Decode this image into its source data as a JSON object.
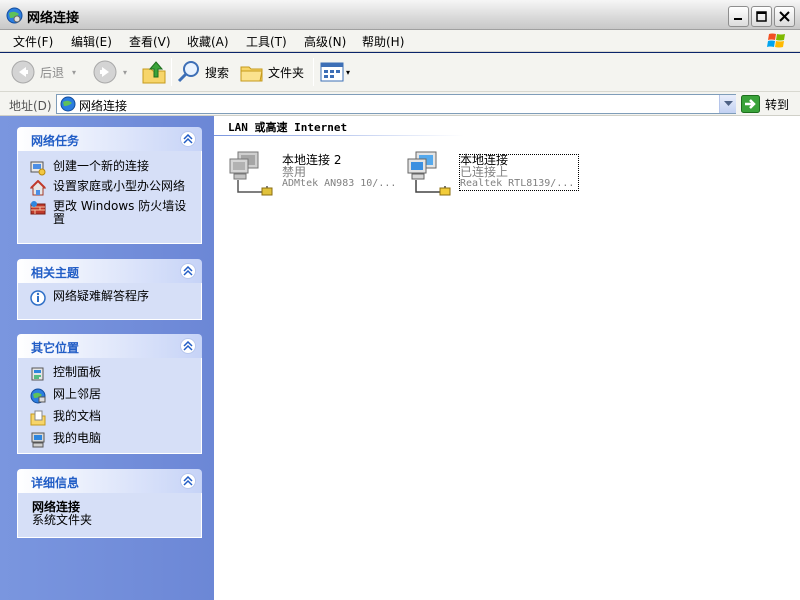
{
  "window": {
    "title": "网络连接",
    "buttons": {
      "minimize": "minimize",
      "maximize": "maximize",
      "close": "close"
    }
  },
  "menu": [
    "文件(F)",
    "编辑(E)",
    "查看(V)",
    "收藏(A)",
    "工具(T)",
    "高级(N)",
    "帮助(H)"
  ],
  "toolbar": {
    "back_label": "后退",
    "search_label": "搜索",
    "folders_label": "文件夹"
  },
  "address": {
    "label": "地址(D)",
    "value": "网络连接",
    "go_label": "转到"
  },
  "sidebar": {
    "panels": [
      {
        "title": "网络任务",
        "items": [
          {
            "label": "创建一个新的连接",
            "icon": "new-connection-icon"
          },
          {
            "label": "设置家庭或小型办公网络",
            "icon": "home-network-icon"
          },
          {
            "label": "更改 Windows 防火墙设置",
            "icon": "firewall-icon"
          }
        ]
      },
      {
        "title": "相关主题",
        "items": [
          {
            "label": "网络疑难解答程序",
            "icon": "info-icon"
          }
        ]
      },
      {
        "title": "其它位置",
        "items": [
          {
            "label": "控制面板",
            "icon": "control-panel-icon"
          },
          {
            "label": "网上邻居",
            "icon": "network-places-icon"
          },
          {
            "label": "我的文档",
            "icon": "my-documents-icon"
          },
          {
            "label": "我的电脑",
            "icon": "my-computer-icon"
          }
        ]
      },
      {
        "title": "详细信息",
        "details": {
          "name": "网络连接",
          "type": "系统文件夹"
        }
      }
    ]
  },
  "main": {
    "group_title": "LAN 或高速 Internet",
    "connections": [
      {
        "name": "本地连接 2",
        "status": "禁用",
        "device": "ADMtek AN983 10/...",
        "enabled": false
      },
      {
        "name": "本地连接",
        "status": "已连接上",
        "device": "Realtek RTL8139/...",
        "enabled": true
      }
    ]
  },
  "colors": {
    "sidebar_bg": "#7a96df",
    "panel_title": "#215dc6",
    "panel_body": "#d6dff7"
  }
}
